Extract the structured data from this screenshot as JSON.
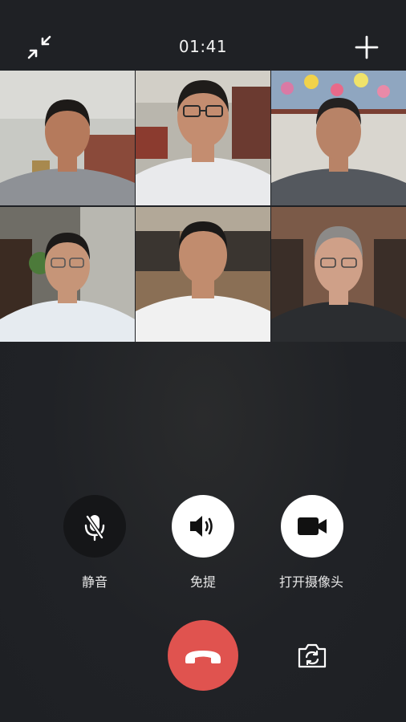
{
  "call": {
    "timer": "01:41"
  },
  "topbar": {
    "minimize_icon": "minimize-arrows-icon",
    "add_icon": "plus-icon"
  },
  "participants": [
    {
      "bg": "#c8c9c4",
      "shirt": "#8e9196",
      "skin": "#b57a5c",
      "hair": "#1d1a18"
    },
    {
      "bg": "#b9b6ad",
      "shirt": "#e9eaec",
      "skin": "#c48d70",
      "hair": "#1f1c1a"
    },
    {
      "bg": "#d9d6cf",
      "shirt": "#54585e",
      "skin": "#b88367",
      "hair": "#242120"
    },
    {
      "bg": "#6f6d66",
      "shirt": "#e6ebf0",
      "skin": "#c69578",
      "hair": "#1c1a19"
    },
    {
      "bg": "#8a6f55",
      "shirt": "#f1f1f1",
      "skin": "#c18c6e",
      "hair": "#1b1918"
    },
    {
      "bg": "#7b5a48",
      "shirt": "#2b2d30",
      "skin": "#cfa088",
      "hair": "#8c8a88"
    }
  ],
  "controls": {
    "mute_label": "静音",
    "speaker_label": "免提",
    "camera_label": "打开摄像头",
    "mute_icon": "mic-off-icon",
    "speaker_icon": "speaker-icon",
    "camera_icon": "video-camera-icon",
    "hangup_icon": "hang-up-icon",
    "switch_camera_icon": "switch-camera-icon"
  },
  "colors": {
    "background": "#1f2125",
    "hangup": "#e0534f",
    "button_light": "#ffffff",
    "button_dark": "#151618"
  }
}
